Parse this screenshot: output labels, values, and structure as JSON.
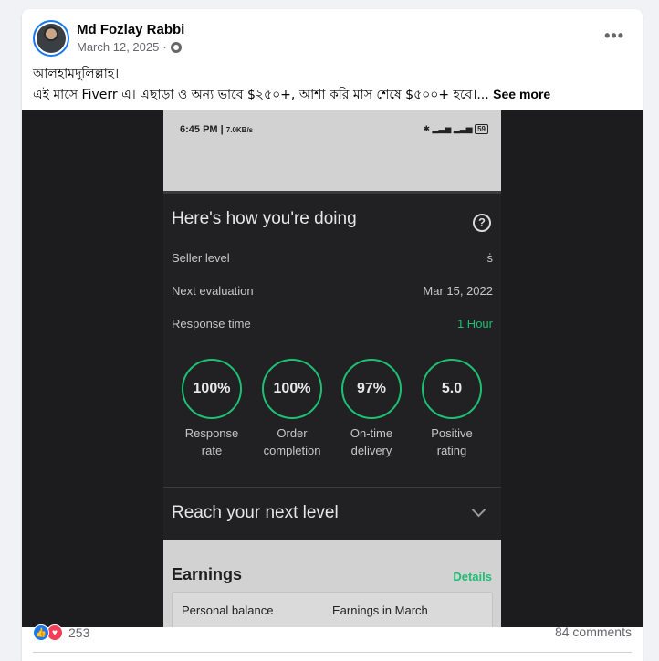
{
  "post": {
    "author": "Md Fozlay Rabbi",
    "date": "March 12, 2025",
    "separator": "·",
    "audience_icon": "globe-icon",
    "more_icon": "•••",
    "text_line1": "আলহামদুলিল্লাহ।",
    "text_line2": " এই মাসে Fiverr এ। এছাড়া ও অন্য ভাবে $২৫০+,  আশা করি মাস শেষে $৫০০+ হবে।...",
    "see_more": "See more"
  },
  "screenshot": {
    "status_time": "6:45 PM",
    "status_speed": "7.0KB/s",
    "status_battery": "59",
    "section_title": "Here's how you're doing",
    "help_icon": "?",
    "seller_level_label": "Seller level",
    "seller_level_value": "ṡ",
    "next_eval_label": "Next evaluation",
    "next_eval_value": "Mar 15, 2022",
    "response_time_label": "Response time",
    "response_time_value": "1 Hour",
    "metrics": [
      {
        "value": "100%",
        "label_line1": "Response",
        "label_line2": "rate"
      },
      {
        "value": "100%",
        "label_line1": "Order",
        "label_line2": "completion"
      },
      {
        "value": "97%",
        "label_line1": "On-time",
        "label_line2": "delivery"
      },
      {
        "value": "5.0",
        "label_line1": "Positive",
        "label_line2": "rating"
      }
    ],
    "reach_title": "Reach your next level",
    "earnings_title": "Earnings",
    "earnings_details": "Details",
    "personal_balance": "Personal balance",
    "earnings_in_march": "Earnings in March"
  },
  "footer": {
    "reaction_count": "253",
    "comments": "84 comments"
  },
  "colors": {
    "fiverr_green": "#1dbf73",
    "facebook_blue": "#1877f2",
    "love_red": "#f33e58"
  }
}
